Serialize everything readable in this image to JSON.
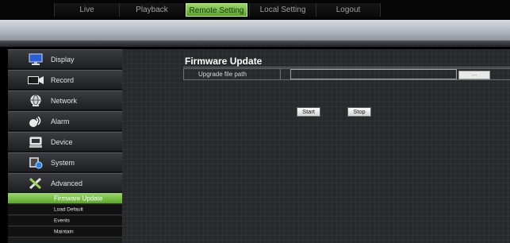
{
  "nav": {
    "tabs": [
      {
        "label": "Live"
      },
      {
        "label": "Playback"
      },
      {
        "label": "Remote Setting",
        "active": true
      },
      {
        "label": "Local Setting"
      },
      {
        "label": "Logout"
      }
    ]
  },
  "sidebar": {
    "items": [
      {
        "label": "Display",
        "icon": "monitor-icon"
      },
      {
        "label": "Record",
        "icon": "camera-icon"
      },
      {
        "label": "Network",
        "icon": "network-globe-icon"
      },
      {
        "label": "Alarm",
        "icon": "alarm-siren-icon"
      },
      {
        "label": "Device",
        "icon": "hard-disk-icon"
      },
      {
        "label": "System",
        "icon": "system-icon"
      },
      {
        "label": "Advanced",
        "icon": "tools-icon"
      }
    ],
    "subitems": [
      {
        "label": "Firmware Update",
        "active": true
      },
      {
        "label": "Load Default"
      },
      {
        "label": "Events"
      },
      {
        "label": "Maintain"
      }
    ]
  },
  "main": {
    "title": "Firmware Update",
    "upgrade_label": "Upgrade file path",
    "path_value": "",
    "browse_label": "....",
    "start_label": "Start",
    "stop_label": "Stop"
  },
  "colors": {
    "accent_green": "#7cc24a",
    "background": "#000000",
    "panel": "#27292c"
  }
}
